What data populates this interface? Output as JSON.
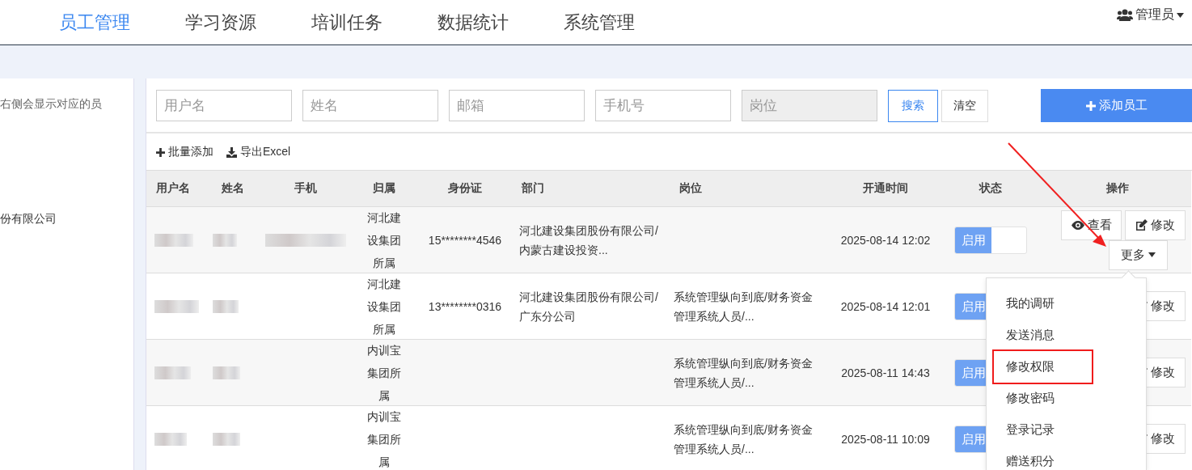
{
  "nav": {
    "items": [
      {
        "label": "员工管理",
        "selected": true
      },
      {
        "label": "学习资源",
        "selected": false
      },
      {
        "label": "培训任务",
        "selected": false
      },
      {
        "label": "数据统计",
        "selected": false
      },
      {
        "label": "系统管理",
        "selected": false
      }
    ],
    "user": "管理员"
  },
  "sidebar": {
    "hint": "右侧会显示对应的员",
    "tree_item": "份有限公司"
  },
  "search": {
    "fields": [
      {
        "placeholder": "用户名",
        "disabled": false
      },
      {
        "placeholder": "姓名",
        "disabled": false
      },
      {
        "placeholder": "邮箱",
        "disabled": false
      },
      {
        "placeholder": "手机号",
        "disabled": false
      },
      {
        "placeholder": "岗位",
        "disabled": true
      }
    ],
    "buttons": [
      {
        "label": "搜索",
        "kind": "primary"
      },
      {
        "label": "清空",
        "kind": "plain"
      }
    ],
    "add_button": "添加员工"
  },
  "toolbar": [
    {
      "label": "批量添加",
      "kind": "plus"
    },
    {
      "label": "导出Excel",
      "kind": "download"
    }
  ],
  "table": {
    "columns": [
      "用户名",
      "姓名",
      "手机",
      "归属",
      "身份证",
      "部门",
      "岗位",
      "开通时间",
      "状态",
      "操作"
    ],
    "rows": [
      {
        "affiliation": "河北建设集团所属",
        "id_card": "15********4546",
        "department": "河北建设集团股份有限公司/内蒙古建设投资...",
        "position": "",
        "opened": "2025-08-14 12:02",
        "status": "启用",
        "enabled": true,
        "actions": [
          {
            "label": "查看",
            "kind": "view"
          },
          {
            "label": "修改",
            "kind": "edit"
          },
          {
            "label": "更多",
            "kind": "more"
          }
        ]
      },
      {
        "affiliation": "河北建设集团所属",
        "id_card": "13********0316",
        "department": "河北建设集团股份有限公司/广东分公司",
        "position": "系统管理纵向到底/财务资金管理系统人员/...",
        "opened": "2025-08-14 12:01",
        "status": "启用",
        "enabled": true,
        "actions": [
          {
            "label": "修改",
            "kind": "edit"
          }
        ]
      },
      {
        "affiliation": "内训宝集团所属",
        "id_card": "",
        "department": "",
        "position": "系统管理纵向到底/财务资金管理系统人员/...",
        "opened": "2025-08-11 14:43",
        "status": "启用",
        "enabled": true,
        "actions": [
          {
            "label": "修改",
            "kind": "edit"
          }
        ]
      },
      {
        "affiliation": "内训宝集团所属",
        "id_card": "",
        "department": "",
        "position": "系统管理纵向到底/财务资金管理系统人员/...",
        "opened": "2025-08-11 10:09",
        "status": "启用",
        "enabled": true,
        "actions": [
          {
            "label": "修改",
            "kind": "edit"
          }
        ]
      }
    ]
  },
  "more_menu": {
    "items": [
      {
        "label": "我的调研",
        "annotated": false
      },
      {
        "label": "发送消息",
        "annotated": false
      },
      {
        "label": "修改权限",
        "annotated": true
      },
      {
        "label": "修改密码",
        "annotated": false
      },
      {
        "label": "登录记录",
        "annotated": false
      },
      {
        "label": "赠送积分",
        "annotated": false
      }
    ]
  }
}
